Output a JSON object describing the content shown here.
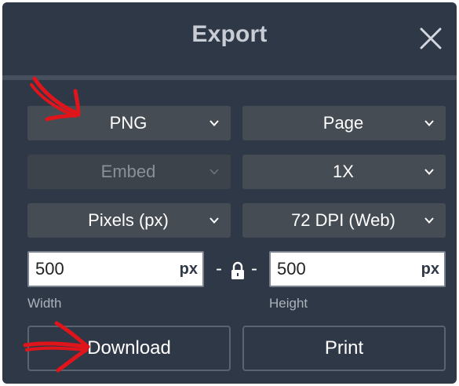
{
  "dialog": {
    "title": "Export",
    "close_icon": "close-icon"
  },
  "format_select": {
    "value": "PNG"
  },
  "scope_select": {
    "value": "Page"
  },
  "embed_select": {
    "value": "Embed",
    "disabled": true
  },
  "scale_select": {
    "value": "1X"
  },
  "units_select": {
    "value": "Pixels (px)"
  },
  "dpi_select": {
    "value": "72 DPI (Web)"
  },
  "width_field": {
    "value": "500",
    "unit": "px",
    "label": "Width"
  },
  "height_field": {
    "value": "500",
    "unit": "px",
    "label": "Height"
  },
  "lock": {
    "left_dash": "-",
    "right_dash": "-",
    "icon": "lock-icon"
  },
  "actions": {
    "download_label": "Download",
    "print_label": "Print"
  },
  "colors": {
    "panel_bg": "#2f3846",
    "select_bg": "#464c54",
    "annotation_red": "#e0141b"
  }
}
